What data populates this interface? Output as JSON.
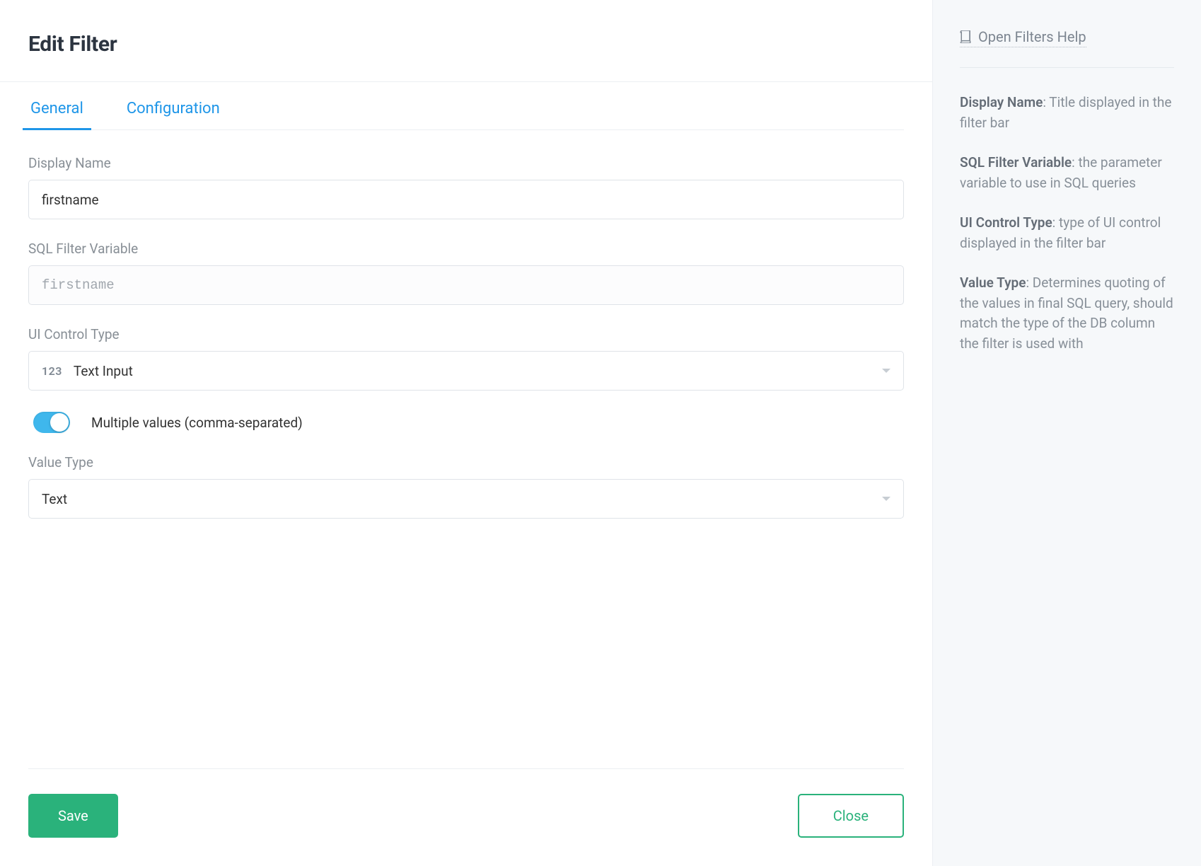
{
  "page_title": "Edit Filter",
  "tabs": {
    "general": "General",
    "configuration": "Configuration"
  },
  "form": {
    "display_name_label": "Display Name",
    "display_name_value": "firstname",
    "sql_var_label": "SQL Filter Variable",
    "sql_var_value": "firstname",
    "ui_control_label": "UI Control Type",
    "ui_control_prefix": "123",
    "ui_control_value": "Text Input",
    "multi_toggle_label": "Multiple values (comma-separated)",
    "multi_toggle_on": true,
    "value_type_label": "Value Type",
    "value_type_value": "Text"
  },
  "footer": {
    "save": "Save",
    "close": "Close"
  },
  "help": {
    "link": "Open Filters Help",
    "items": [
      {
        "term": "Display Name",
        "desc": ": Title displayed in the filter bar"
      },
      {
        "term": "SQL Filter Variable",
        "desc": ": the parameter variable to use in SQL queries"
      },
      {
        "term": "UI Control Type",
        "desc": ": type of UI control displayed in the filter bar"
      },
      {
        "term": "Value Type",
        "desc": ": Determines quoting of the values in final SQL query, should match the type of the DB column the filter is used with"
      }
    ]
  }
}
